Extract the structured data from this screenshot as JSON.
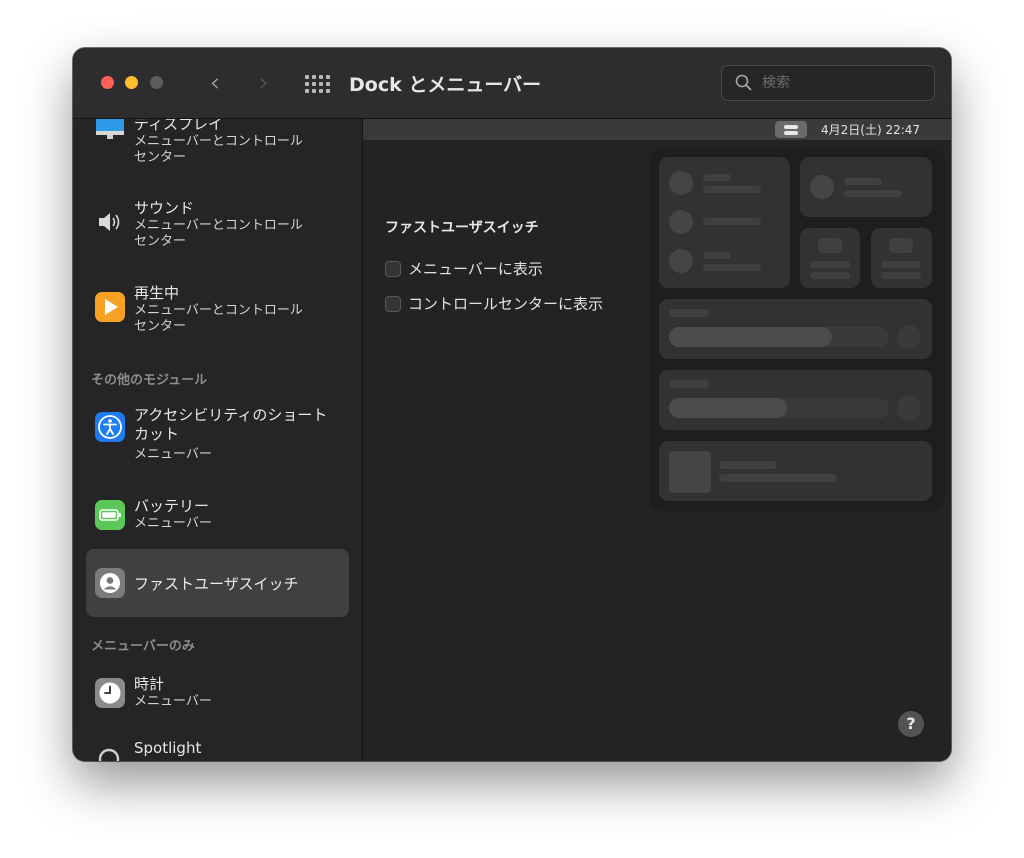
{
  "window": {
    "title": "Dock とメニューバー",
    "search_placeholder": "検索"
  },
  "menubar_preview": {
    "datetime": "4月2日(土)  22:47"
  },
  "sidebar": {
    "items": [
      {
        "name": "ディスプレイ",
        "sub": "メニューバーとコントロール\nセンター",
        "icon": "display-icon"
      },
      {
        "name": "サウンド",
        "sub": "メニューバーとコントロール\nセンター",
        "icon": "speaker-icon"
      },
      {
        "name": "再生中",
        "sub": "メニューバーとコントロール\nセンター",
        "icon": "play-icon"
      }
    ],
    "section_other": "その他のモジュール",
    "other_items": [
      {
        "name": "アクセシビリティのショート\nカット",
        "sub": "メニューバー",
        "icon": "accessibility-icon"
      },
      {
        "name": "バッテリー",
        "sub": "メニューバー",
        "icon": "battery-icon"
      },
      {
        "name": "ファストユーザスイッチ",
        "sub": "",
        "icon": "user-switch-icon",
        "selected": true
      }
    ],
    "section_menubar": "メニューバーのみ",
    "menubar_items": [
      {
        "name": "時計",
        "sub": "メニューバー",
        "icon": "clock-icon"
      },
      {
        "name": "Spotlight",
        "sub": "",
        "icon": "spotlight-icon"
      }
    ]
  },
  "main": {
    "section_title": "ファストユーザスイッチ",
    "options": [
      {
        "label": "メニューバーに表示",
        "checked": false
      },
      {
        "label": "コントロールセンターに表示",
        "checked": false
      }
    ]
  },
  "help_label": "?",
  "colors": {
    "selected_bg": "#403f42",
    "play_orange": "#f6a124",
    "accessibility_blue": "#1e7cf2",
    "battery_green": "#5cc85a"
  }
}
